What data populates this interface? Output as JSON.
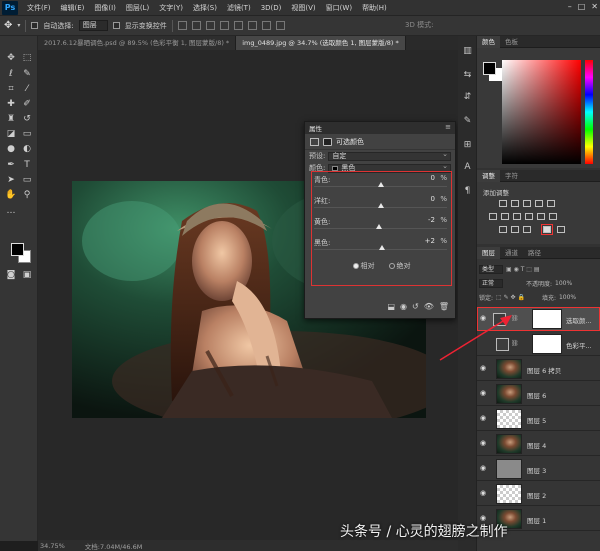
{
  "app": {
    "logo": "Ps"
  },
  "menu": [
    "文件(F)",
    "编辑(E)",
    "图像(I)",
    "图层(L)",
    "文字(Y)",
    "选择(S)",
    "滤镜(T)",
    "3D(D)",
    "视图(V)",
    "窗口(W)",
    "帮助(H)"
  ],
  "window_controls": {
    "minimize": "–",
    "maximize": "□",
    "close": "✕"
  },
  "options_bar": {
    "auto_select_label": "自动选择:",
    "auto_select_value": "图层",
    "show_transform_label": "显示变换控件",
    "mode_3d_label": "3D 模式:"
  },
  "tabs": [
    {
      "label": "2017.6.12暴晒调色.psd @ 89.5% (色彩平衡 1, 图层蒙版/8) *",
      "active": false
    },
    {
      "label": "img_0489.jpg @ 34.7% (选取颜色 1, 图层蒙版/8) *",
      "active": true
    }
  ],
  "status": {
    "zoom": "34.75%",
    "doc": "文档:7.04M/46.6M"
  },
  "properties": {
    "header": "属性",
    "menu_glyph": "≡",
    "subtitle": "可选颜色",
    "preset_label": "预设:",
    "preset_value": "自定",
    "colors_label": "颜色:",
    "colors_value": "黑色",
    "sliders": [
      {
        "label": "青色:",
        "value": "0",
        "unit": "%",
        "position": 0.5
      },
      {
        "label": "洋红:",
        "value": "0",
        "unit": "%",
        "position": 0.5
      },
      {
        "label": "黄色:",
        "value": "-2",
        "unit": "%",
        "position": 0.49
      },
      {
        "label": "黑色:",
        "value": "+2",
        "unit": "%",
        "position": 0.51
      }
    ],
    "method_relative": "相对",
    "method_absolute": "绝对",
    "method_selected": "relative"
  },
  "panels": {
    "color_tabs": [
      "颜色",
      "色板"
    ],
    "adjust_tabs": [
      "调整",
      "字符"
    ],
    "adjust_title": "添加调整",
    "layers_tabs": [
      "图层",
      "通道",
      "路径"
    ],
    "filter_kind": "类型",
    "blend_mode": "正常",
    "opacity_label": "不透明度:",
    "opacity_value": "100%",
    "lock_label": "锁定:",
    "fill_label": "填充:",
    "fill_value": "100%",
    "layers": [
      {
        "name": "选取颜...",
        "kind": "adjustment",
        "selected": true
      },
      {
        "name": "色彩平...",
        "kind": "adjustment",
        "selected": false
      },
      {
        "name": "图层 6 拷贝",
        "kind": "photo",
        "selected": false
      },
      {
        "name": "图层 6",
        "kind": "photo",
        "selected": false
      },
      {
        "name": "图层 5",
        "kind": "transparent",
        "selected": false
      },
      {
        "name": "图层 4",
        "kind": "photo",
        "selected": false
      },
      {
        "name": "图层 3",
        "kind": "gray",
        "selected": false
      },
      {
        "name": "图层 2",
        "kind": "transparent",
        "selected": false
      },
      {
        "name": "图层 1",
        "kind": "photo",
        "selected": false
      }
    ]
  },
  "watermark": "头条号 / 心灵的翅膀之制作"
}
